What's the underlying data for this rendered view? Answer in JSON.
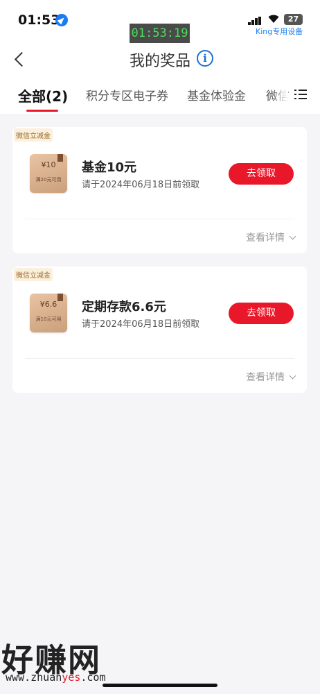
{
  "status_bar": {
    "time": "01:53",
    "clock_overlay": "01:53:19",
    "battery": "27",
    "device_label": "King专用设备"
  },
  "header": {
    "title": "我的奖品"
  },
  "tabs": [
    {
      "label": "全部(2)",
      "active": true
    },
    {
      "label": "积分专区电子券",
      "active": false
    },
    {
      "label": "基金体验金",
      "active": false
    },
    {
      "label": "微信",
      "active": false
    }
  ],
  "cards": [
    {
      "tag": "微信立减金",
      "coupon_amount": "¥10",
      "coupon_condition": "满20元可用",
      "name": "基金10元",
      "deadline": "请于2024年06月18日前领取",
      "button": "去领取",
      "details": "查看详情"
    },
    {
      "tag": "微信立减金",
      "coupon_amount": "¥6.6",
      "coupon_condition": "满10元可用",
      "name": "定期存款6.6元",
      "deadline": "请于2024年06月18日前领取",
      "button": "去领取",
      "details": "查看详情"
    }
  ],
  "watermark": {
    "logo": "好赚网",
    "url_prefix": "www.zhuan",
    "url_accent": "yes",
    "url_suffix": ".com"
  },
  "colors": {
    "accent": "#e9172a",
    "info": "#1a6fd6",
    "tag_text": "#9a6a2b"
  }
}
